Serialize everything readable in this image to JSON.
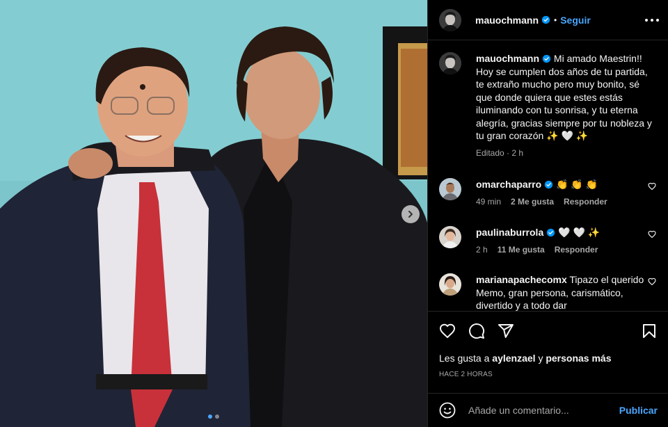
{
  "post": {
    "username": "mauochmann",
    "separator": "•",
    "follow_label": "Seguir",
    "caption_text": "Mi amado Maestrin!! Hoy se cumplen dos años de tu partida, te extraño mucho pero muy bonito, sé que donde quiera que estes estás iluminando con tu sonrisa, y tu eterna alegría, gracias siempre por tu nobleza y tu gran corazón ✨ 🤍 ✨",
    "caption_meta": "Editado · 2 h"
  },
  "carousel": {
    "current_index": 1,
    "total": 2
  },
  "comments": [
    {
      "username": "omarchaparro",
      "text": "👏 👏 👏",
      "time": "49 min",
      "likes": "2 Me gusta",
      "reply": "Responder",
      "verified": true
    },
    {
      "username": "paulinaburrola",
      "text": "🤍 🤍 ✨",
      "time": "2 h",
      "likes": "11 Me gusta",
      "reply": "Responder",
      "verified": true
    },
    {
      "username": "marianapachecomx",
      "text": "Tipazo el querido Memo, gran persona, carismático, divertido y a todo dar",
      "verified": false
    }
  ],
  "likes": {
    "prefix": "Les gusta a",
    "user": "aylenzael",
    "connector": "y",
    "rest": "personas más"
  },
  "timestamp": "HACE 2 HORAS",
  "add_comment": {
    "placeholder": "Añade un comentario...",
    "publish_label": "Publicar"
  },
  "colors": {
    "accent": "#4aa6ff",
    "verified": "#0095f6",
    "background": "#000000",
    "divider": "#262626"
  }
}
